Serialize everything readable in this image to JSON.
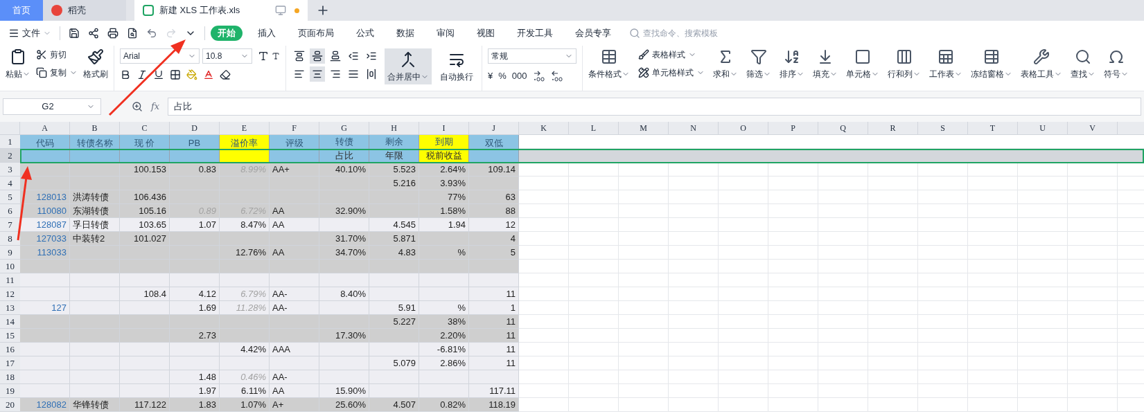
{
  "tabs": [
    {
      "label": "首页",
      "kind": "home",
      "selected": false
    },
    {
      "label": "稻壳",
      "kind": "docer",
      "selected": false
    },
    {
      "label": "新建 XLS 工作表.xls",
      "kind": "file",
      "selected": true,
      "unsaved": true
    }
  ],
  "menu": {
    "file_label": "文件",
    "items": [
      {
        "label": "开始",
        "selected": true
      },
      {
        "label": "插入",
        "selected": false
      },
      {
        "label": "页面布局",
        "selected": false
      },
      {
        "label": "公式",
        "selected": false
      },
      {
        "label": "数据",
        "selected": false
      },
      {
        "label": "审阅",
        "selected": false
      },
      {
        "label": "视图",
        "selected": false
      },
      {
        "label": "开发工具",
        "selected": false
      },
      {
        "label": "会员专享",
        "selected": false
      }
    ],
    "search_placeholder": "查找命令、搜索模板"
  },
  "clipboard": {
    "paste": "粘贴",
    "cut": "剪切",
    "copy": "复制",
    "format_painter": "格式刷"
  },
  "font": {
    "name": "Arial",
    "size": "10.8"
  },
  "align_buttons": [
    {
      "kind": "top",
      "selected": false
    },
    {
      "kind": "middle",
      "selected": true
    },
    {
      "kind": "bottom",
      "selected": false
    },
    {
      "kind": "outdent",
      "selected": false
    },
    {
      "kind": "indent",
      "selected": false
    },
    {
      "kind": "left",
      "selected": false
    },
    {
      "kind": "center",
      "selected": true
    },
    {
      "kind": "right",
      "selected": false
    },
    {
      "kind": "justify",
      "selected": false
    },
    {
      "kind": "distributed",
      "selected": false
    }
  ],
  "merge": {
    "label": "合并居中",
    "selected": true
  },
  "wrap": {
    "label": "自动换行",
    "selected": false
  },
  "number": {
    "format": "常规",
    "buttons": [
      "¥",
      "%",
      "000"
    ]
  },
  "style_tools": [
    {
      "label": "表格样式",
      "kind": "style"
    },
    {
      "label": "单元格样式",
      "kind": "cellstyle"
    }
  ],
  "tools": [
    {
      "label": "条件格式",
      "kind": "table",
      "dropdown": true
    },
    {
      "label": "求和",
      "kind": "sum",
      "dropdown": true
    },
    {
      "label": "筛选",
      "kind": "filter",
      "dropdown": true
    },
    {
      "label": "排序",
      "kind": "sort",
      "dropdown": true
    },
    {
      "label": "填充",
      "kind": "fill",
      "dropdown": true
    },
    {
      "label": "单元格",
      "kind": "cell",
      "dropdown": true
    },
    {
      "label": "行和列",
      "kind": "rowcol",
      "dropdown": true
    },
    {
      "label": "工作表",
      "kind": "sheet",
      "dropdown": true
    },
    {
      "label": "冻结窗格",
      "kind": "freeze",
      "dropdown": true
    },
    {
      "label": "表格工具",
      "kind": "tools",
      "dropdown": true
    },
    {
      "label": "查找",
      "kind": "find",
      "dropdown": true
    },
    {
      "label": "符号",
      "kind": "symbol",
      "dropdown": true
    }
  ],
  "formula_bar": {
    "cell_ref": "G2",
    "function_label": "fx",
    "value": "占比"
  },
  "columns": [
    "A",
    "B",
    "C",
    "D",
    "E",
    "F",
    "G",
    "H",
    "I",
    "J",
    "K",
    "L",
    "M",
    "N",
    "O",
    "P",
    "Q",
    "R",
    "S",
    "T",
    "U",
    "V"
  ],
  "header_rows": [
    {
      "num": "1",
      "selected": false
    },
    {
      "num": "2",
      "selected": true
    }
  ],
  "header": [
    {
      "kind": "merged",
      "text": "代码",
      "color": "#8cc4e4"
    },
    {
      "kind": "merged",
      "text": "转债名称",
      "color": "#8cc4e4"
    },
    {
      "kind": "merged",
      "text": "现 价",
      "color": "#8cc4e4"
    },
    {
      "kind": "merged",
      "text": "PB",
      "color": "#8cc4e4"
    },
    {
      "kind": "merged",
      "text": "溢价率",
      "color": "#ffff00"
    },
    {
      "kind": "merged",
      "text": "评级",
      "color": "#8cc4e4"
    },
    {
      "kind": "split",
      "top": "转债",
      "bottom": "占比",
      "color": "#8cc4e4"
    },
    {
      "kind": "split",
      "top": "剩余",
      "bottom": "年限",
      "color": "#8cc4e4"
    },
    {
      "kind": "split",
      "top": "到期",
      "bottom": "税前收益",
      "color": "#ffff00"
    },
    {
      "kind": "merged",
      "text": "双低",
      "color": "#8cc4e4"
    }
  ],
  "rows": [
    {
      "num": "3",
      "shaded": true,
      "muted": [
        false,
        false,
        false,
        false,
        true,
        false,
        false,
        false,
        false,
        false
      ],
      "cells": [
        "",
        "",
        "100.153",
        "0.83",
        "8.99%",
        "AA+",
        "40.10%",
        "5.523",
        "2.64%",
        "109.14"
      ]
    },
    {
      "num": "4",
      "shaded": true,
      "cells": [
        "",
        "",
        "",
        "",
        "",
        "",
        "",
        "5.216",
        "3.93%",
        ""
      ]
    },
    {
      "num": "5",
      "shaded": true,
      "cells": [
        "128013",
        "洪涛转债",
        "106.436",
        "",
        "",
        "",
        "",
        "",
        "77%",
        "63"
      ]
    },
    {
      "num": "6",
      "shaded": true,
      "muted": [
        false,
        false,
        false,
        true,
        true,
        false,
        false,
        false,
        false,
        false
      ],
      "cells": [
        "110080",
        "东湖转债",
        "105.16",
        "0.89",
        "6.72%",
        "AA",
        "32.90%",
        "",
        "1.58%",
        "88"
      ]
    },
    {
      "num": "7",
      "shaded": false,
      "cells": [
        "128087",
        "孚日转债",
        "103.65",
        "1.07",
        "8.47%",
        "AA",
        "",
        "4.545",
        "1.94",
        "12"
      ]
    },
    {
      "num": "8",
      "shaded": true,
      "cells": [
        "127033",
        "中装转2",
        "101.027",
        "",
        "",
        "",
        "31.70%",
        "5.871",
        "",
        "4"
      ]
    },
    {
      "num": "9",
      "shaded": true,
      "cells": [
        "113033",
        "",
        "",
        "",
        "12.76%",
        "AA",
        "34.70%",
        "4.83",
        "%",
        "5"
      ]
    },
    {
      "num": "10",
      "shaded": true,
      "cells": [
        "",
        "",
        "",
        "",
        "",
        "",
        "",
        "",
        "",
        ""
      ]
    },
    {
      "num": "11",
      "shaded": false,
      "cells": [
        "",
        "",
        "",
        "",
        "",
        "",
        "",
        "",
        "",
        ""
      ]
    },
    {
      "num": "12",
      "shaded": false,
      "muted": [
        false,
        false,
        false,
        false,
        true,
        false,
        false,
        false,
        false,
        false
      ],
      "cells": [
        "",
        "",
        "108.4",
        "4.12",
        "6.79%",
        "AA-",
        "8.40%",
        "",
        "",
        "11"
      ]
    },
    {
      "num": "13",
      "shaded": false,
      "muted": [
        false,
        false,
        false,
        false,
        true,
        false,
        false,
        false,
        false,
        false
      ],
      "cells": [
        "127",
        "",
        "",
        "1.69",
        "11.28%",
        "AA-",
        "",
        "5.91",
        "%",
        "1"
      ]
    },
    {
      "num": "14",
      "shaded": true,
      "cells": [
        "",
        "",
        "",
        "",
        "",
        "",
        "",
        "5.227",
        "38%",
        "11"
      ]
    },
    {
      "num": "15",
      "shaded": true,
      "cells": [
        "",
        "",
        "",
        "2.73",
        "",
        "",
        "17.30%",
        "",
        "2.20%",
        "11"
      ]
    },
    {
      "num": "16",
      "shaded": false,
      "cells": [
        "",
        "",
        "",
        "",
        "4.42%",
        "AAA",
        "",
        "",
        "-6.81%",
        "11"
      ]
    },
    {
      "num": "17",
      "shaded": false,
      "cells": [
        "",
        "",
        "",
        "",
        "",
        "",
        "",
        "5.079",
        "2.86%",
        "11"
      ]
    },
    {
      "num": "18",
      "shaded": false,
      "muted": [
        false,
        false,
        false,
        false,
        true,
        false,
        false,
        false,
        false,
        false
      ],
      "cells": [
        "",
        "",
        "",
        "1.48",
        "0.46%",
        "AA-",
        "",
        "",
        "",
        ""
      ]
    },
    {
      "num": "19",
      "shaded": false,
      "cells": [
        "",
        "",
        "",
        "1.97",
        "6.11%",
        "AA",
        "15.90%",
        "",
        "",
        "117.11"
      ]
    },
    {
      "num": "20",
      "shaded": true,
      "cells": [
        "128082",
        "华锋转债",
        "117.122",
        "1.83",
        "1.07%",
        "A+",
        "25.60%",
        "4.507",
        "0.82%",
        "118.19"
      ]
    }
  ]
}
